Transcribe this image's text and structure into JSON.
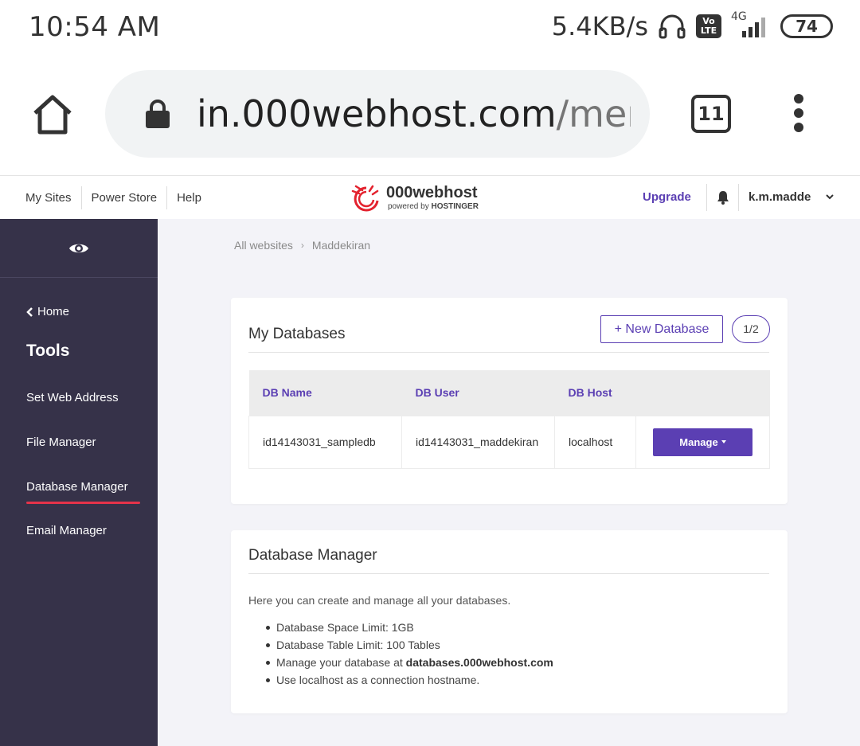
{
  "status_bar": {
    "time": "10:54 AM",
    "net_speed": "5.4KB/s",
    "volte_top": "Vo",
    "volte_bottom": "LTE",
    "network_type": "4G",
    "battery": "74"
  },
  "browser": {
    "url_host": "in.000webhost.com",
    "url_path": "/memb",
    "tab_count": "11"
  },
  "header": {
    "nav": [
      "My Sites",
      "Power Store",
      "Help"
    ],
    "logo_name": "000webhost",
    "logo_sub_prefix": "powered by",
    "logo_sub_brand": "HOSTINGER",
    "upgrade": "Upgrade",
    "username": "k.m.madde"
  },
  "sidebar": {
    "home": "Home",
    "section": "Tools",
    "items": [
      "Set Web Address",
      "File Manager",
      "Database Manager",
      "Email Manager"
    ],
    "active_item": "Database Manager"
  },
  "breadcrumb": [
    "All websites",
    "Maddekiran"
  ],
  "databases_card": {
    "title": "My Databases",
    "new_button": "+ New Database",
    "count": "1/2",
    "columns": [
      "DB Name",
      "DB User",
      "DB Host"
    ],
    "rows": [
      {
        "name": "id14143031_sampledb",
        "user": "id14143031_maddekiran",
        "host": "localhost",
        "action": "Manage"
      }
    ]
  },
  "manager_card": {
    "title": "Database Manager",
    "intro": "Here you can create and manage all your databases.",
    "bullets": [
      "Database Space Limit: 1GB",
      "Database Table Limit: 100 Tables",
      "Manage your database at"
    ],
    "manage_link": "databases.000webhost.com",
    "last_bullet": "Use localhost as a connection hostname."
  },
  "colors": {
    "accent": "#5b3fb3",
    "sidebar_bg": "#363249",
    "active_underline": "#e5334a",
    "logo_red": "#e3222e"
  }
}
